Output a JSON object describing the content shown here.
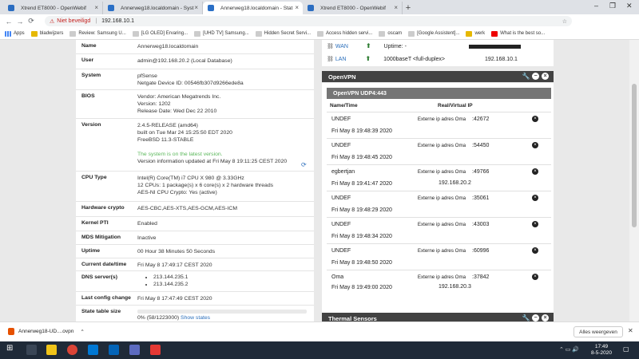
{
  "browser": {
    "tabs": [
      {
        "title": "Xtrend ET8000 - OpenWebif",
        "active": false
      },
      {
        "title": "Annerweg18.localdomain - Syst",
        "active": false
      },
      {
        "title": "Annerweg18.localdomain - Stat",
        "active": true
      },
      {
        "title": "Xtrend ET8000 - OpenWebif",
        "active": false
      }
    ],
    "new_tab": "+",
    "security_label": "Niet beveiligd",
    "url": "192.168.10.1",
    "profile_initial": "E",
    "bookmarks": [
      "Apps",
      "bladwijzers",
      "Review: Samsung U...",
      "[LG OLED] Ervaring...",
      "[UHD TV] Samsung...",
      "Hidden Secret Servi...",
      "Access hidden servi...",
      "oscam",
      "[Google Assistent]...",
      "werk",
      "What is the best so..."
    ]
  },
  "system_info": {
    "rows": [
      {
        "label": "Name",
        "lines": [
          "Annerweg18.localdomain"
        ]
      },
      {
        "label": "User",
        "lines": [
          "admin@192.168.20.2 (Local Database)"
        ]
      },
      {
        "label": "System",
        "lines": [
          "pfSense",
          "Netgate Device ID: 00546fb307d9266ede8a"
        ]
      },
      {
        "label": "BIOS",
        "lines": [
          "Vendor: American Megatrends Inc.",
          "Version: 1202",
          "Release Date: Wed Dec 22 2010"
        ]
      },
      {
        "label": "Version",
        "lines": [
          "2.4.5-RELEASE (amd64)",
          "built on Tue Mar 24 15:25:50 EDT 2020",
          "FreeBSD 11.3-STABLE"
        ]
      },
      {
        "label": "CPU Type",
        "lines": [
          "Intel(R) Core(TM) i7 CPU X 980 @ 3.33GHz",
          "12 CPUs: 1 package(s) x 6 core(s) x 2 hardware threads",
          "AES-NI CPU Crypto: Yes (active)"
        ]
      },
      {
        "label": "Hardware crypto",
        "lines": [
          "AES-CBC,AES-XTS,AES-GCM,AES-ICM"
        ]
      },
      {
        "label": "Kernel PTI",
        "lines": [
          "Enabled"
        ]
      },
      {
        "label": "MDS Mitigation",
        "lines": [
          "Inactive"
        ]
      },
      {
        "label": "Uptime",
        "lines": [
          "00 Hour 38 Minutes 50 Seconds"
        ]
      },
      {
        "label": "Current date/time",
        "lines": [
          "Fri May 8 17:49:17 CEST 2020"
        ]
      },
      {
        "label": "DNS server(s)",
        "lines": []
      },
      {
        "label": "Last config change",
        "lines": [
          "Fri May 8 17:47:49 CEST 2020"
        ]
      },
      {
        "label": "State table size",
        "lines": []
      }
    ],
    "version_status": "The system is on the latest version.",
    "version_updated": "Version information updated at Fri May 8 19:11:25 CEST 2020",
    "dns_servers": [
      "213.144.235.1",
      "213.144.235.2"
    ],
    "state_table": {
      "text": "0% (58/1223000)",
      "link": "Show states",
      "fraction": 0.0
    }
  },
  "interfaces": [
    {
      "name": "WAN",
      "info": "Uptime: -",
      "ip": ""
    },
    {
      "name": "LAN",
      "info": "1000baseT <full-duplex>",
      "ip": "192.168.10.1"
    }
  ],
  "openvpn": {
    "title": "OpenVPN",
    "server": "OpenVPN UDP4:443",
    "col_name": "Name/Time",
    "col_addr": "Real/Virtual IP",
    "clients": [
      {
        "name": "UNDEF",
        "time": "Fri May 8 19:48:39 2020",
        "real_ip": "Externe ip adres Oma",
        "port": ":42672",
        "virtual_ip": ""
      },
      {
        "name": "UNDEF",
        "time": "Fri May 8 19:48:45 2020",
        "real_ip": "Externe ip adres Oma",
        "port": ":54450",
        "virtual_ip": ""
      },
      {
        "name": "egbertjan",
        "time": "Fri May 8 19:41:47 2020",
        "real_ip": "Externe ip adres Oma",
        "port": ":49766",
        "virtual_ip": "192.168.20.2"
      },
      {
        "name": "UNDEF",
        "time": "Fri May 8 19:48:29 2020",
        "real_ip": "Externe ip adres Oma",
        "port": ":35061",
        "virtual_ip": ""
      },
      {
        "name": "UNDEF",
        "time": "Fri May 8 19:48:34 2020",
        "real_ip": "Externe ip adres Oma",
        "port": ":43003",
        "virtual_ip": ""
      },
      {
        "name": "UNDEF",
        "time": "Fri May 8 19:48:50 2020",
        "real_ip": "Externe ip adres Oma",
        "port": ":60996",
        "virtual_ip": ""
      },
      {
        "name": "Oma",
        "time": "Fri May 8 19:49:00 2020",
        "real_ip": "Externe ip adres Oma",
        "port": ":37842",
        "virtual_ip": "192.168.20.3"
      }
    ]
  },
  "thermal": {
    "title": "Thermal Sensors"
  },
  "download": {
    "file": "Annerweg18-UD....ovpn",
    "show_all": "Alles weergeven"
  },
  "taskbar": {
    "time": "17:49",
    "date": "8-5-2020"
  },
  "colors": {
    "panel_header": "#424242",
    "link": "#2a6ebb",
    "ok_green": "#5cb85c",
    "taskbar": "#1f2a38"
  }
}
